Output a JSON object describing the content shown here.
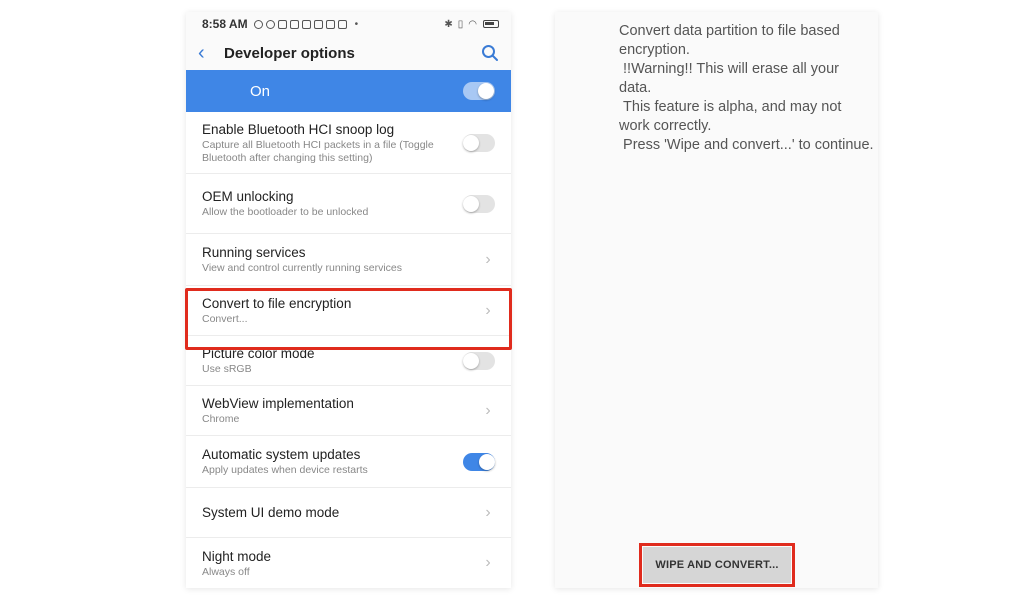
{
  "status_bar": {
    "time": "8:58 AM",
    "dot": "•"
  },
  "app_bar": {
    "title": "Developer options"
  },
  "master_switch": {
    "label": "On",
    "state": "on"
  },
  "settings": [
    {
      "title": "Enable Bluetooth HCI snoop log",
      "subtitle": "Capture all Bluetooth HCI packets in a file (Toggle Bluetooth after changing this setting)",
      "control": "toggle-off"
    },
    {
      "title": "OEM unlocking",
      "subtitle": "Allow the bootloader to be unlocked",
      "control": "toggle-off"
    },
    {
      "title": "Running services",
      "subtitle": "View and control currently running services",
      "control": "chevron"
    },
    {
      "title": "Convert to file encryption",
      "subtitle": "Convert...",
      "control": "chevron"
    },
    {
      "title": "Picture color mode",
      "subtitle": "Use sRGB",
      "control": "toggle-off"
    },
    {
      "title": "WebView implementation",
      "subtitle": "Chrome",
      "control": "chevron"
    },
    {
      "title": "Automatic system updates",
      "subtitle": "Apply updates when device restarts",
      "control": "toggle-on"
    },
    {
      "title": "System UI demo mode",
      "subtitle": "",
      "control": "chevron"
    },
    {
      "title": "Night mode",
      "subtitle": "Always off",
      "control": "chevron"
    }
  ],
  "encryption_screen": {
    "message": "Convert data partition to file based encryption.\n !!Warning!! This will erase all your data.\n This feature is alpha, and may not work correctly.\n Press 'Wipe and convert...' to continue.",
    "button_label": "WIPE AND CONVERT..."
  },
  "colors": {
    "accent": "#3f86e6",
    "highlight": "#e02b1d"
  }
}
